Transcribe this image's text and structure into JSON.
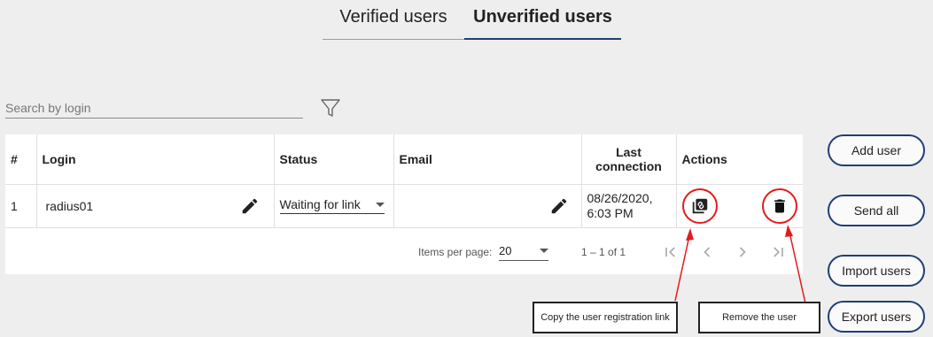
{
  "tabs": [
    {
      "label": "Verified users",
      "active": false
    },
    {
      "label": "Unverified users",
      "active": true
    }
  ],
  "search": {
    "placeholder": "Search by login",
    "value": ""
  },
  "table": {
    "headers": {
      "num": "#",
      "login": "Login",
      "status": "Status",
      "email": "Email",
      "last_line1": "Last",
      "last_line2": "connection",
      "actions": "Actions"
    },
    "rows": [
      {
        "num": "1",
        "login": "radius01",
        "status": "Waiting for link",
        "email": "",
        "last_line1": "08/26/2020,",
        "last_line2": "6:03 PM"
      }
    ]
  },
  "pager": {
    "items_per_page_label": "Items per page:",
    "items_per_page_value": "20",
    "range": "1 – 1 of 1"
  },
  "buttons": {
    "add_user": "Add user",
    "send_all": "Send all",
    "import_users": "Import users",
    "export_users": "Export users"
  },
  "callouts": {
    "copy": "Copy the user registration link",
    "remove": "Remove the user"
  },
  "colors": {
    "accent": "#1f3f74",
    "highlight": "#e31b1b"
  },
  "icons": [
    "filter-icon",
    "pencil-icon",
    "link-copy-icon",
    "trash-icon",
    "first-page-icon",
    "prev-page-icon",
    "next-page-icon",
    "last-page-icon"
  ]
}
